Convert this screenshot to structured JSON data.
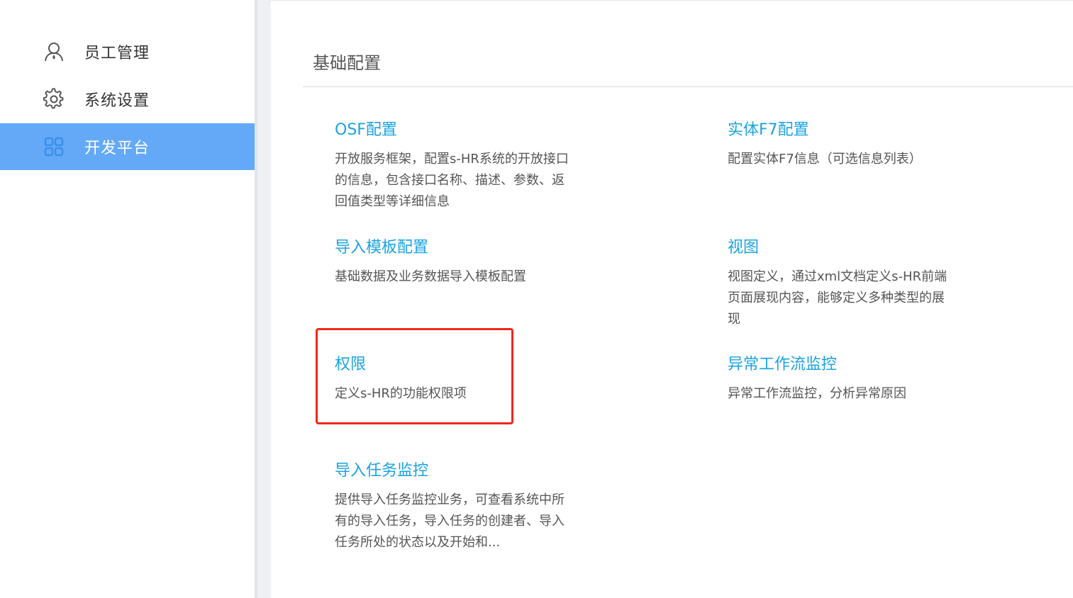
{
  "sidebar": {
    "items": [
      {
        "label": "员工管理",
        "icon": "user-icon",
        "active": false
      },
      {
        "label": "系统设置",
        "icon": "gear-icon",
        "active": false
      },
      {
        "label": "开发平台",
        "icon": "grid-apps-icon",
        "active": true
      }
    ]
  },
  "main": {
    "section_title": "基础配置",
    "cards": [
      {
        "title": "OSF配置",
        "desc": "开放服务框架，配置s-HR系统的开放接口的信息，包含接口名称、描述、参数、返回值类型等详细信息"
      },
      {
        "title": "实体F7配置",
        "desc": "配置实体F7信息（可选信息列表）"
      },
      {
        "title": "导入模板配置",
        "desc": "基础数据及业务数据导入模板配置"
      },
      {
        "title": "视图",
        "desc": "视图定义，通过xml文档定义s-HR前端页面展现内容，能够定义多种类型的展现"
      },
      {
        "title": "权限",
        "desc": "定义s-HR的功能权限项"
      },
      {
        "title": "异常工作流监控",
        "desc": "异常工作流监控，分析异常原因"
      },
      {
        "title": "导入任务监控",
        "desc": "提供导入任务监控业务，可查看系统中所有的导入任务，导入任务的创建者、导入任务所处的状态以及开始和..."
      }
    ]
  },
  "colors": {
    "accent": "#64a9f7",
    "link": "#1aa3e0",
    "highlight": "#f0261b"
  }
}
